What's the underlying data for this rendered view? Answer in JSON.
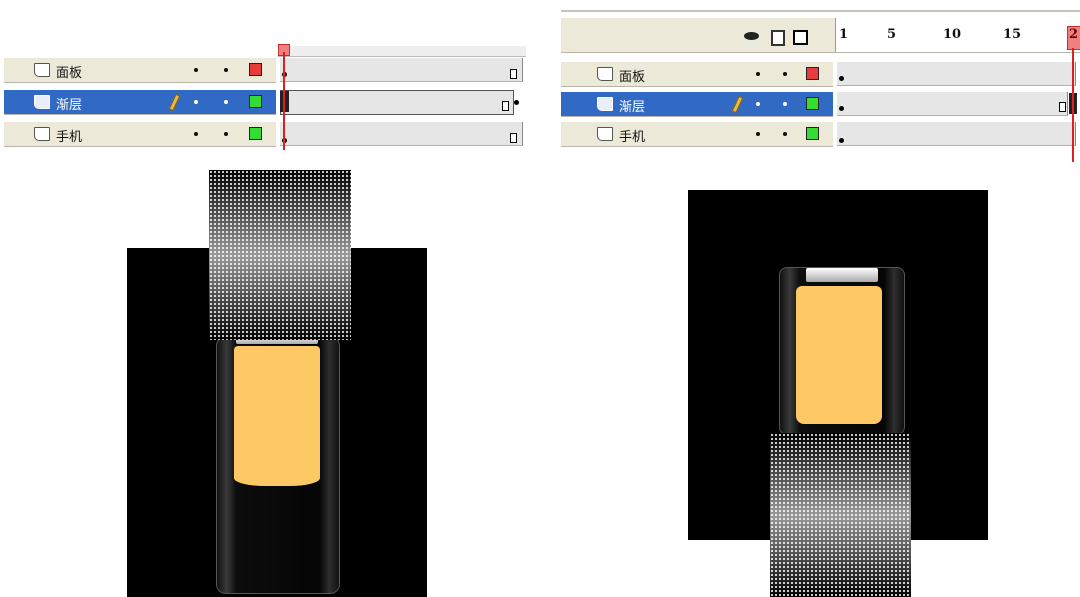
{
  "left_panel": {
    "layers": [
      {
        "name": "面板",
        "swatch_color": "#e83c3c",
        "selected": false,
        "editing": false
      },
      {
        "name": "渐层",
        "swatch_color": "#33dd33",
        "selected": true,
        "editing": true
      },
      {
        "name": "手机",
        "swatch_color": "#33dd33",
        "selected": false,
        "editing": false
      }
    ]
  },
  "right_panel": {
    "header_icons": [
      "eye-icon",
      "lock-icon",
      "outline-icon"
    ],
    "frame_numbers": [
      "1",
      "5",
      "10",
      "15",
      "2"
    ],
    "layers": [
      {
        "name": "面板",
        "swatch_color": "#e83c3c",
        "selected": false,
        "editing": false
      },
      {
        "name": "渐层",
        "swatch_color": "#33dd33",
        "selected": true,
        "editing": true
      },
      {
        "name": "手机",
        "swatch_color": "#33dd33",
        "selected": false,
        "editing": false
      }
    ]
  },
  "colors": {
    "selection": "#316ac5",
    "playhead": "#e02020",
    "screen": "#fdc964",
    "stage": "#000000"
  }
}
